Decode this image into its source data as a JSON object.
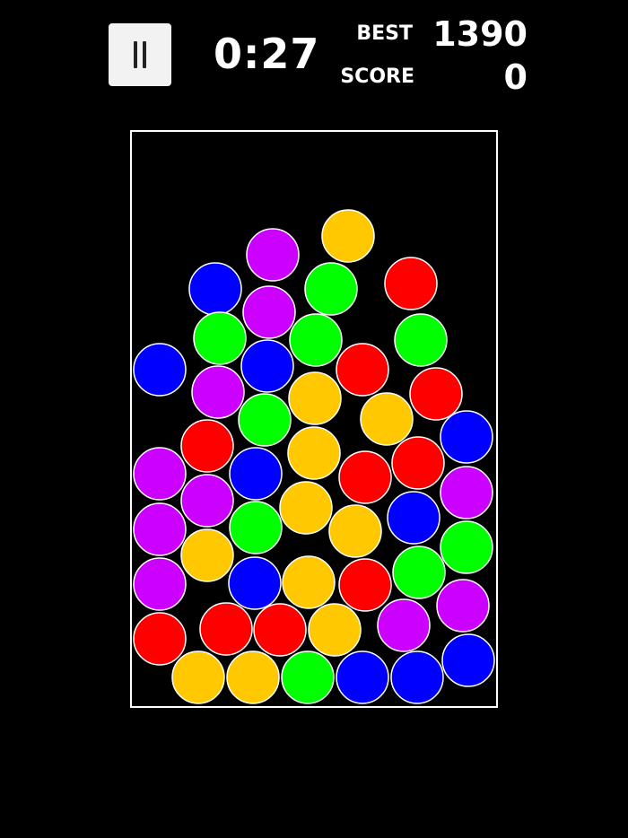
{
  "hud": {
    "timer": "0:27",
    "best_label": "BEST",
    "best_value": "1390",
    "score_label": "SCORE",
    "score_value": "0",
    "pause_icon": "pause-icon"
  },
  "palette": {
    "red": "#ff0000",
    "blue": "#0000ff",
    "green": "#00ff00",
    "yellow": "#ffc800",
    "purple": "#cc00ff",
    "board_border": "#ffffff",
    "background": "#000000"
  },
  "balls": [
    "yellow",
    "purple",
    "blue",
    "green",
    "red",
    "purple",
    "green",
    "green",
    "green",
    "blue",
    "blue",
    "red",
    "purple",
    "yellow",
    "red",
    "green",
    "yellow",
    "blue",
    "red",
    "yellow",
    "purple",
    "blue",
    "red",
    "red",
    "purple",
    "purple",
    "yellow",
    "blue",
    "green",
    "purple",
    "green",
    "yellow",
    "yellow",
    "green",
    "purple",
    "yellow",
    "blue",
    "purple",
    "red",
    "yellow",
    "purple",
    "red",
    "red",
    "red",
    "yellow",
    "yellow",
    "green",
    "blue",
    "blue",
    "blue",
    "purple",
    "purple"
  ]
}
